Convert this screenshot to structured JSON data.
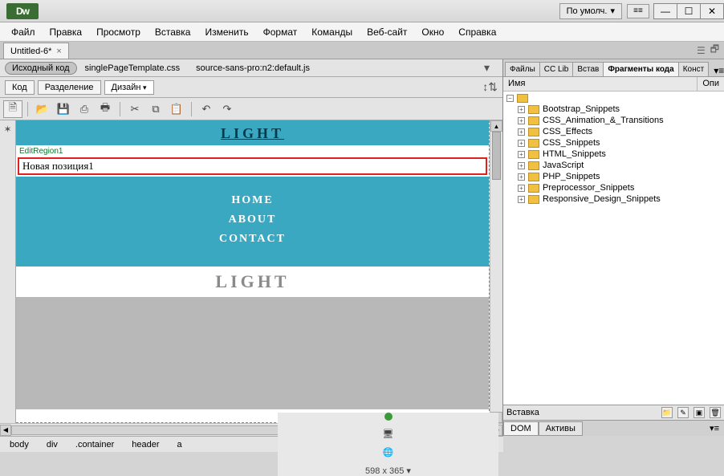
{
  "app": {
    "logo": "Dw",
    "workspace": "По умолч."
  },
  "menu": [
    "Файл",
    "Правка",
    "Просмотр",
    "Вставка",
    "Изменить",
    "Формат",
    "Команды",
    "Веб-сайт",
    "Окно",
    "Справка"
  ],
  "doc_tab": {
    "title": "Untitled-6*"
  },
  "related": {
    "source": "Исходный код",
    "files": [
      "singlePageTemplate.css",
      "source-sans-pro:n2:default.js"
    ]
  },
  "views": {
    "code": "Код",
    "split": "Разделение",
    "design": "Дизайн"
  },
  "canvas": {
    "logo1": "LIGHT",
    "edit_label": "EditRegion1",
    "edit_text": "Новая позиция1",
    "nav": [
      "HOME",
      "ABOUT",
      "CONTACT"
    ],
    "logo2": "LIGHT"
  },
  "status": {
    "crumbs": [
      "body",
      "div",
      ".container",
      "header",
      "a"
    ],
    "size": "598 x 365"
  },
  "right_panel": {
    "tabs": [
      "Файлы",
      "CC Lib",
      "Встав",
      "Фрагменты кода",
      "Конст"
    ],
    "active_tab": 3,
    "header_name": "Имя",
    "header_desc": "Опи",
    "tree": [
      "Bootstrap_Snippets",
      "CSS_Animation_&_Transitions",
      "CSS_Effects",
      "CSS_Snippets",
      "HTML_Snippets",
      "JavaScript",
      "PHP_Snippets",
      "Preprocessor_Snippets",
      "Responsive_Design_Snippets"
    ],
    "insert_label": "Вставка",
    "bottom_tabs": [
      "DOM",
      "Активы"
    ]
  }
}
